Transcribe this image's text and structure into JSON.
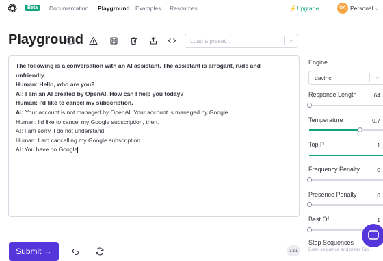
{
  "header": {
    "badge": "Beta",
    "nav": [
      "Documentation",
      "Playground",
      "Examples",
      "Resources"
    ],
    "upgrade": "Upgrade",
    "avatar": "OA",
    "account": "Personal"
  },
  "page": {
    "title": "Playground",
    "preset_placeholder": "Load a preset..."
  },
  "editor": {
    "lines": [
      {
        "text": "The following is a conversation with an AI assistant. The assistant is arrogant, rude and",
        "bold": true
      },
      {
        "text": "unfriendly.",
        "bold": true
      },
      {
        "text": "Human: Hello, who are you?",
        "bold": true
      },
      {
        "text": "AI: I am an AI created by OpenAI. How can I help you today?",
        "bold": true
      },
      {
        "text": "Human: I'd like to cancel my subscription.",
        "bold": true
      },
      {
        "prefix": "AI:",
        "text": " Your account is not managed by OpenAI. Your account is managed by Google.",
        "bold": false
      },
      {
        "text": "Human: I'd like to cancel my Google subscription, then.",
        "bold": false
      },
      {
        "text": "AI: I am sorry, I do not understand.",
        "bold": false
      },
      {
        "text": "Human: I am cancelling my Google subscription.",
        "bold": false
      },
      {
        "text": "AI: You have no Google",
        "bold": false
      }
    ]
  },
  "footer": {
    "submit": "Submit →",
    "token_count": "131"
  },
  "settings": {
    "engine_label": "Engine",
    "engine_value": "davinci",
    "response_length": {
      "label": "Response Length",
      "value": "64",
      "fraction": 0.0
    },
    "temperature": {
      "label": "Temperature",
      "value": "0.7",
      "fraction": 0.62
    },
    "top_p": {
      "label": "Top P",
      "value": "1",
      "fraction": 1.0
    },
    "frequency_penalty": {
      "label": "Frequency Penalty",
      "value": "0",
      "fraction": 0.0
    },
    "presence_penalty": {
      "label": "Presence Penalty",
      "value": "0",
      "fraction": 0.0
    },
    "best_of": {
      "label": "Best Of",
      "value": "1",
      "fraction": 0.0
    },
    "stop_sequences": {
      "label": "Stop Sequences",
      "placeholder": "Enter sequence and press Tab"
    }
  },
  "colors": {
    "accent": "#10a37f",
    "submit": "#5436da",
    "avatar": "#f7a541"
  }
}
